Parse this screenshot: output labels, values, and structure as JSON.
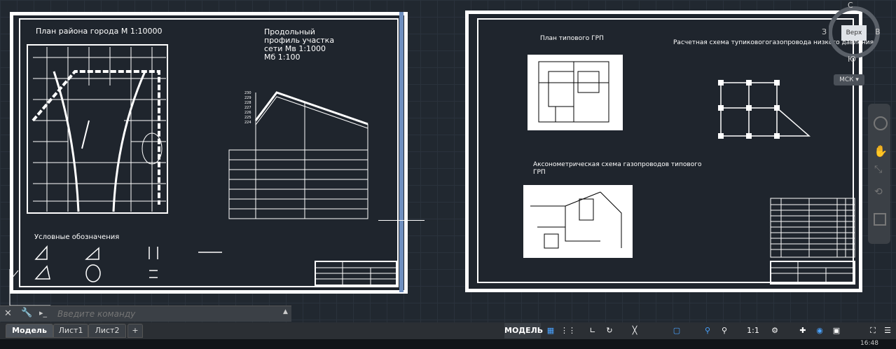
{
  "sheet_left": {
    "title": "План района города М 1:10000",
    "profile_title": [
      "Продольный",
      "профиль участка",
      "сети Мв 1:1000",
      "Мб 1:100"
    ],
    "legend_title": "Условные обозначения",
    "axis_values": [
      "230",
      "229",
      "228",
      "227",
      "226",
      "225",
      "224"
    ]
  },
  "sheet_right": {
    "grp_plan_title": "План типового ГРП",
    "scheme_title": "Расчетная схема тупиковогогазопровода низкого давления",
    "axon_title_1": "Аксонометрическая схема газопроводов типового",
    "axon_title_2": "ГРП"
  },
  "viewcube": {
    "north": "С",
    "south": "Ю",
    "west": "З",
    "east": "В",
    "top": "Верх",
    "ucs": "МСК"
  },
  "command": {
    "placeholder": "Введите команду"
  },
  "tabs": [
    "Модель",
    "Лист1",
    "Лист2",
    "+"
  ],
  "status": {
    "model": "МОДЕЛЬ",
    "scale": "1:1"
  },
  "clock": "16:48"
}
